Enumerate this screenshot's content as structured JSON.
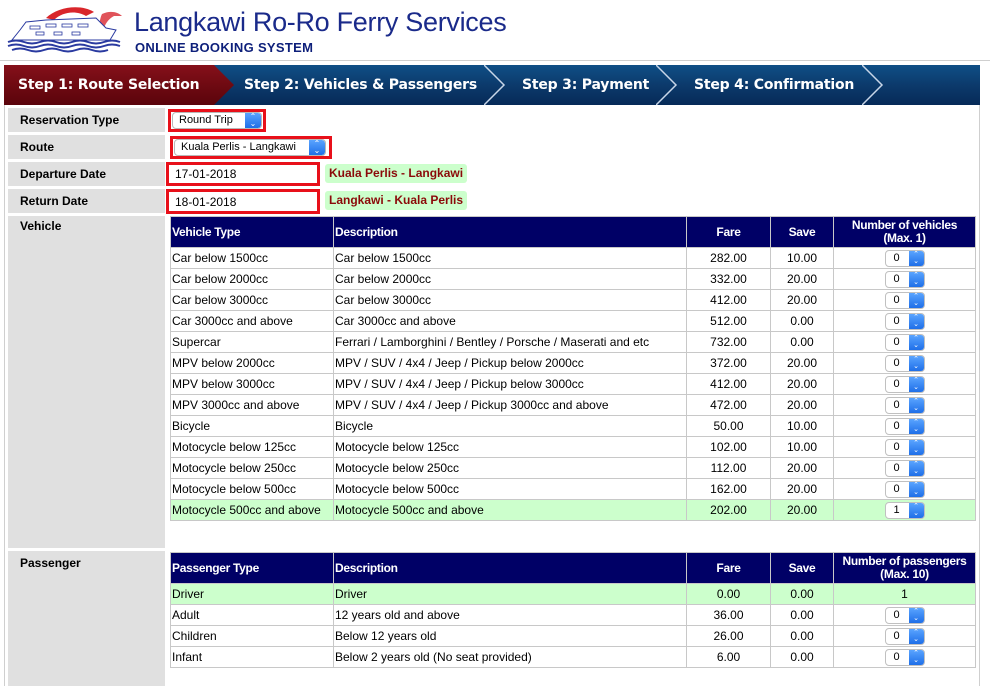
{
  "header": {
    "title": "Langkawi Ro-Ro Ferry Services",
    "subtitle": "ONLINE BOOKING SYSTEM",
    "logo_icon": "ferry-ship-logo"
  },
  "steps": [
    {
      "label": "Step 1: Route Selection",
      "active": true
    },
    {
      "label": "Step 2: Vehicles & Passengers",
      "active": false
    },
    {
      "label": "Step 3: Payment",
      "active": false
    },
    {
      "label": "Step 4: Confirmation",
      "active": false
    }
  ],
  "form": {
    "reservation_type": {
      "label": "Reservation Type",
      "value": "Round Trip"
    },
    "route": {
      "label": "Route",
      "value": "Kuala Perlis - Langkawi"
    },
    "departure_date": {
      "label": "Departure Date",
      "value": "17-01-2018",
      "badge": "Kuala Perlis - Langkawi"
    },
    "return_date": {
      "label": "Return Date",
      "value": "18-01-2018",
      "badge": "Langkawi - Kuala Perlis"
    },
    "vehicle_label": "Vehicle",
    "passenger_label": "Passenger"
  },
  "vehicles": {
    "headers": {
      "type": "Vehicle Type",
      "description": "Description",
      "fare": "Fare",
      "save": "Save",
      "qty_line1": "Number of vehicles",
      "qty_line2": "(Max. 1)"
    },
    "rows": [
      {
        "type": "Car below 1500cc",
        "description": "Car below 1500cc",
        "fare": "282.00",
        "save": "10.00",
        "qty": "0",
        "selected": false
      },
      {
        "type": "Car below 2000cc",
        "description": "Car below 2000cc",
        "fare": "332.00",
        "save": "20.00",
        "qty": "0",
        "selected": false
      },
      {
        "type": "Car below 3000cc",
        "description": "Car below 3000cc",
        "fare": "412.00",
        "save": "20.00",
        "qty": "0",
        "selected": false
      },
      {
        "type": "Car 3000cc and above",
        "description": "Car 3000cc and above",
        "fare": "512.00",
        "save": "0.00",
        "qty": "0",
        "selected": false
      },
      {
        "type": "Supercar",
        "description": "Ferrari / Lamborghini / Bentley / Porsche / Maserati and etc",
        "fare": "732.00",
        "save": "0.00",
        "qty": "0",
        "selected": false
      },
      {
        "type": "MPV below 2000cc",
        "description": "MPV / SUV / 4x4 / Jeep / Pickup below 2000cc",
        "fare": "372.00",
        "save": "20.00",
        "qty": "0",
        "selected": false
      },
      {
        "type": "MPV below 3000cc",
        "description": "MPV / SUV / 4x4 / Jeep / Pickup below 3000cc",
        "fare": "412.00",
        "save": "20.00",
        "qty": "0",
        "selected": false
      },
      {
        "type": "MPV 3000cc and above",
        "description": "MPV / SUV / 4x4 / Jeep / Pickup 3000cc and above",
        "fare": "472.00",
        "save": "20.00",
        "qty": "0",
        "selected": false
      },
      {
        "type": "Bicycle",
        "description": "Bicycle",
        "fare": "50.00",
        "save": "10.00",
        "qty": "0",
        "selected": false
      },
      {
        "type": "Motocycle below 125cc",
        "description": "Motocycle below 125cc",
        "fare": "102.00",
        "save": "10.00",
        "qty": "0",
        "selected": false
      },
      {
        "type": "Motocycle below 250cc",
        "description": "Motocycle below 250cc",
        "fare": "112.00",
        "save": "20.00",
        "qty": "0",
        "selected": false
      },
      {
        "type": "Motocycle below 500cc",
        "description": "Motocycle below 500cc",
        "fare": "162.00",
        "save": "20.00",
        "qty": "0",
        "selected": false
      },
      {
        "type": "Motocycle 500cc and above",
        "description": "Motocycle 500cc and above",
        "fare": "202.00",
        "save": "20.00",
        "qty": "1",
        "selected": true
      }
    ]
  },
  "passengers": {
    "headers": {
      "type": "Passenger Type",
      "description": "Description",
      "fare": "Fare",
      "save": "Save",
      "qty_line1": "Number of passengers",
      "qty_line2": "(Max. 10)"
    },
    "rows": [
      {
        "type": "Driver",
        "description": "Driver",
        "fare": "0.00",
        "save": "0.00",
        "qty": "1",
        "selected": true,
        "fixed": true
      },
      {
        "type": "Adult",
        "description": "12 years old and above",
        "fare": "36.00",
        "save": "0.00",
        "qty": "0",
        "selected": false,
        "fixed": false
      },
      {
        "type": "Children",
        "description": "Below 12 years old",
        "fare": "26.00",
        "save": "0.00",
        "qty": "0",
        "selected": false,
        "fixed": false
      },
      {
        "type": "Infant",
        "description": "Below 2 years old (No seat provided)",
        "fare": "6.00",
        "save": "0.00",
        "qty": "0",
        "selected": false,
        "fixed": false
      }
    ]
  },
  "colors": {
    "brand_blue": "#1a2a8a",
    "active_step": "#6f0a12",
    "step_bar": "#0c3a6c",
    "table_header": "#000066",
    "selected_row": "#ccffcc",
    "highlight_border": "#e8101a",
    "badge_text": "#8b0a0a"
  }
}
